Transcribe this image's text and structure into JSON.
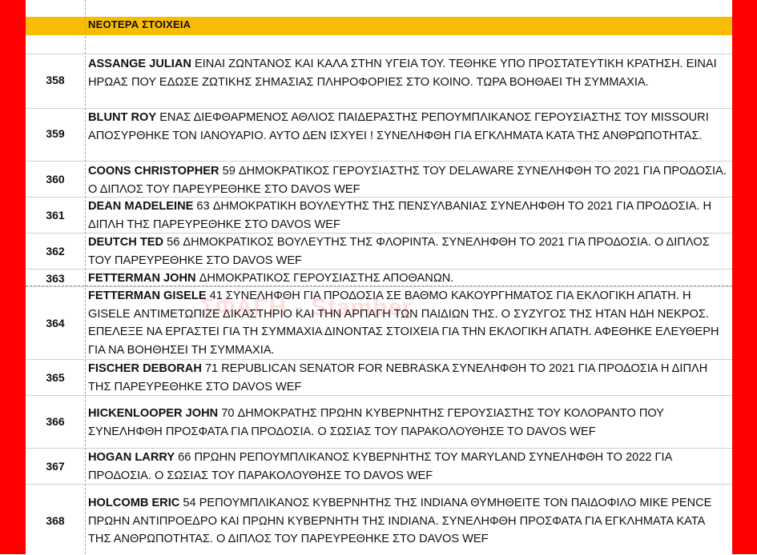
{
  "header": {
    "title": "ΝΕΟΤΕΡΑ ΣΤΟΙΧΕΙΑ"
  },
  "watermark": "ΣΦΑΓΗ - Stamber",
  "colors": {
    "frame": "#ff0000",
    "header_bg": "#f9bc04",
    "grid": "#d0d0d0"
  },
  "rows": [
    {
      "num": "358",
      "name": "ASSANGE JULIAN",
      "text": " ΕΙΝΑΙ ΖΩΝΤΑΝΟΣ ΚΑΙ ΚΑΛΑ ΣΤΗΝ ΥΓΕΙΑ ΤΟΥ. ΤΕΘΗΚΕ ΥΠΟ ΠΡΟΣΤΑΤΕΥΤΙΚΗ ΚΡΑΤΗΣΗ. ΕΙΝΑΙ ΗΡΩΑΣ ΠΟΥ ΕΔΩΣΕ ΖΩΤΙΚΗΣ ΣΗΜΑΣΙΑΣ ΠΛΗΡΟΦΟΡΙΕΣ ΣΤΟ ΚΟΙΝΟ. ΤΩΡΑ ΒΟΗΘΑΕΙ ΤΗ ΣΥΜΜΑΧΙΑ."
    },
    {
      "num": "359",
      "name": "BLUNT ROY",
      "text": " ΕΝΑΣ ΔΙΕΦΘΑΡΜΕΝΟΣ ΑΘΛΙΟΣ ΠΑΙΔΕΡΑΣΤΗΣ ΡΕΠΟΥΜΠΛΙΚΑΝΟΣ ΓΕΡΟΥΣΙΑΣΤΗΣ ΤΟΥ MISSOURI ΑΠΟΣΥΡΘΗΚΕ ΤΟΝ ΙΑΝΟΥΑΡΙΟ. ΑΥΤΟ ΔΕΝ ΙΣΧΥΕΙ ! ΣΥΝΕΛΗΦΘΗ ΓΙΑ ΕΓΚΛΗΜΑΤΑ ΚΑΤΑ ΤΗΣ ΑΝΘΡΩΠΟΤΗΤΑΣ."
    },
    {
      "num": "360",
      "name": "COONS CHRISTOPHER",
      "text": " 59 ΔΗΜΟΚΡΑΤΙΚΟΣ ΓΕΡΟΥΣΙΑΣΤΗΣ ΤΟΥ DELAWARE ΣΥΝΕΛΗΦΘΗ ΤΟ 2021 ΓΙΑ ΠΡΟΔΟΣΙΑ. Ο ΔΙΠΛΟΣ ΤΟΥ ΠΑΡΕΥΡΕΘΗΚΕ ΣΤΟ DAVOS WEF"
    },
    {
      "num": "361",
      "name": "DEAN MADELEINE",
      "text": " 63 ΔΗΜΟΚΡΑΤΙΚΗ ΒΟΥΛΕΥΤΗΣ ΤΗΣ ΠΕΝΣΥΛΒΑΝΙΑΣ ΣΥΝΕΛΗΦΘΗ ΤΟ 2021 ΓΙΑ ΠΡΟΔΟΣΙΑ. Η ΔΙΠΛΗ ΤΗΣ ΠΑΡΕΥΡΕΘΗΚΕ ΣΤΟ DAVOS WEF"
    },
    {
      "num": "362",
      "name": "DEUTCH TED",
      "text": " 56 ΔΗΜΟΚΡΑΤΙΚΟΣ ΒΟΥΛΕΥΤΗΣ ΤΗΣ ΦΛΟΡΙΝΤΑ. ΣΥΝΕΛΗΦΘΗ ΤΟ 2021 ΓΙΑ ΠΡΟΔΟΣΙΑ. Ο ΔΙΠΛΟΣ ΤΟΥ ΠΑΡΕΥΡΕΘΗΚΕ ΣΤΟ DAVOS WEF"
    },
    {
      "num": "363",
      "name": "FETTERMAN JOHN",
      "text": " ΔΗΜΟΚΡΑΤΙΚΟΣ ΓΕΡΟΥΣΙΑΣΤΗΣ ΑΠΟΘΑΝΩΝ."
    },
    {
      "num": "364",
      "name": "FETTERMAN GISELE",
      "text": " 41 ΣΥΝΕΛΗΦΘΗ ΓΙΑ ΠΡΟΔΟΣΙΑ ΣΕ ΒΑΘΜΟ ΚΑΚΟΥΡΓΗΜΑΤΟΣ ΓΙΑ ΕΚΛΟΓΙΚΗ ΑΠΑΤΗ. Η GISELE ΑΝΤΙΜΕΤΩΠΙΖΕ ΔΙΚΑΣΤΗΡΙΟ ΚΑΙ ΤΗΝ ΑΡΠΑΓΗ ΤΩΝ ΠΑΙΔΙΩΝ ΤΗΣ. Ο ΣΥΖΥΓΟΣ ΤΗΣ ΗΤΑΝ ΗΔΗ ΝΕΚΡΟΣ. ΕΠΕΛΕΞΕ ΝΑ ΕΡΓΑΣΤΕΙ ΓΙΑ ΤΗ ΣΥΜΜΑΧΙΑ ΔΙΝΟΝΤΑΣ ΣΤΟΙΧΕΙΑ ΓΙΑ ΤΗΝ ΕΚΛΟΓΙΚΗ ΑΠΑΤΗ. ΑΦΕΘΗΚΕ ΕΛΕΥΘΕΡΗ ΓΙΑ ΝΑ ΒΟΗΘΗΣΕΙ ΤΗ ΣΥΜΜΑΧΙΑ."
    },
    {
      "num": "365",
      "name": "FISCHER DEBORAH",
      "text": " 71 REPUBLICAN SENATOR FOR NEBRASKA ΣΥΝΕΛΗΦΘΗ ΤΟ 2021 ΓΙΑ ΠΡΟΔΟΣΙΑ Η ΔΙΠΛΗ ΤΗΣ ΠΑΡΕΥΡΕΘΗΚΕ ΣΤΟ DAVOS WEF"
    },
    {
      "num": "366",
      "name": "HICKENLOOPER JOHN",
      "text": " 70 ΔΗΜΟΚΡΑΤΗΣ ΠΡΩΗΝ ΚΥΒΕΡΝΗΤΗΣ ΓΕΡΟΥΣΙΑΣΤΗΣ ΤΟΥ ΚΟΛΟΡΑΝΤΟ ΠΟΥ ΣΥΝΕΛΗΦΘΗ ΠΡΟΣΦΑΤΑ ΓΙΑ ΠΡΟΔΟΣΙΑ. Ο ΣΩΣΙΑΣ ΤΟΥ ΠΑΡΑΚΟΛΟΥΘΗΣΕ ΤΟ DAVOS WEF"
    },
    {
      "num": "367",
      "name": "HOGAN LARRY",
      "text": " 66 ΠΡΩΗΝ ΡΕΠΟΥΜΠΛΙΚΑΝΟΣ ΚΥΒΕΡΝΗΤΗΣ ΤΟΥ MARYLAND ΣΥΝΕΛΗΦΘΗ ΤΟ 2022 ΓΙΑ ΠΡΟΔΟΣΙΑ. Ο ΣΩΣΙΑΣ ΤΟΥ ΠΑΡΑΚΟΛΟΥΘΗΣΕ ΤΟ DAVOS WEF"
    },
    {
      "num": "368",
      "name": "HOLCOMB ERIC",
      "text": " 54 ΡΕΠΟΥΜΠΛΙΚΑΝΟΣ ΚΥΒΕΡΝΗΤΗΣ ΤΗΣ INDIANA ΘΥΜΗΘΕΙΤΕ ΤΟΝ ΠΑΙΔΟΦΙΛΟ MIKE PENCE ΠΡΩΗΝ ΑΝΤΙΠΡΟΕΔΡΟ ΚΑΙ ΠΡΩΗΝ ΚΥΒΕΡΝΗΤΗ ΤΗΣ INDIANA. ΣΥΝΕΛΗΦΘΗ ΠΡΟΣΦΑΤΑ ΓΙΑ ΕΓΚΛΗΜΑΤΑ ΚΑΤΑ ΤΗΣ ΑΝΘΡΩΠΟΤΗΤΑΣ. Ο ΔΙΠΛΟΣ ΤΟΥ ΠΑΡΕΥΡΕΘΗΚΕ ΣΤΟ DAVOS WEF"
    }
  ]
}
